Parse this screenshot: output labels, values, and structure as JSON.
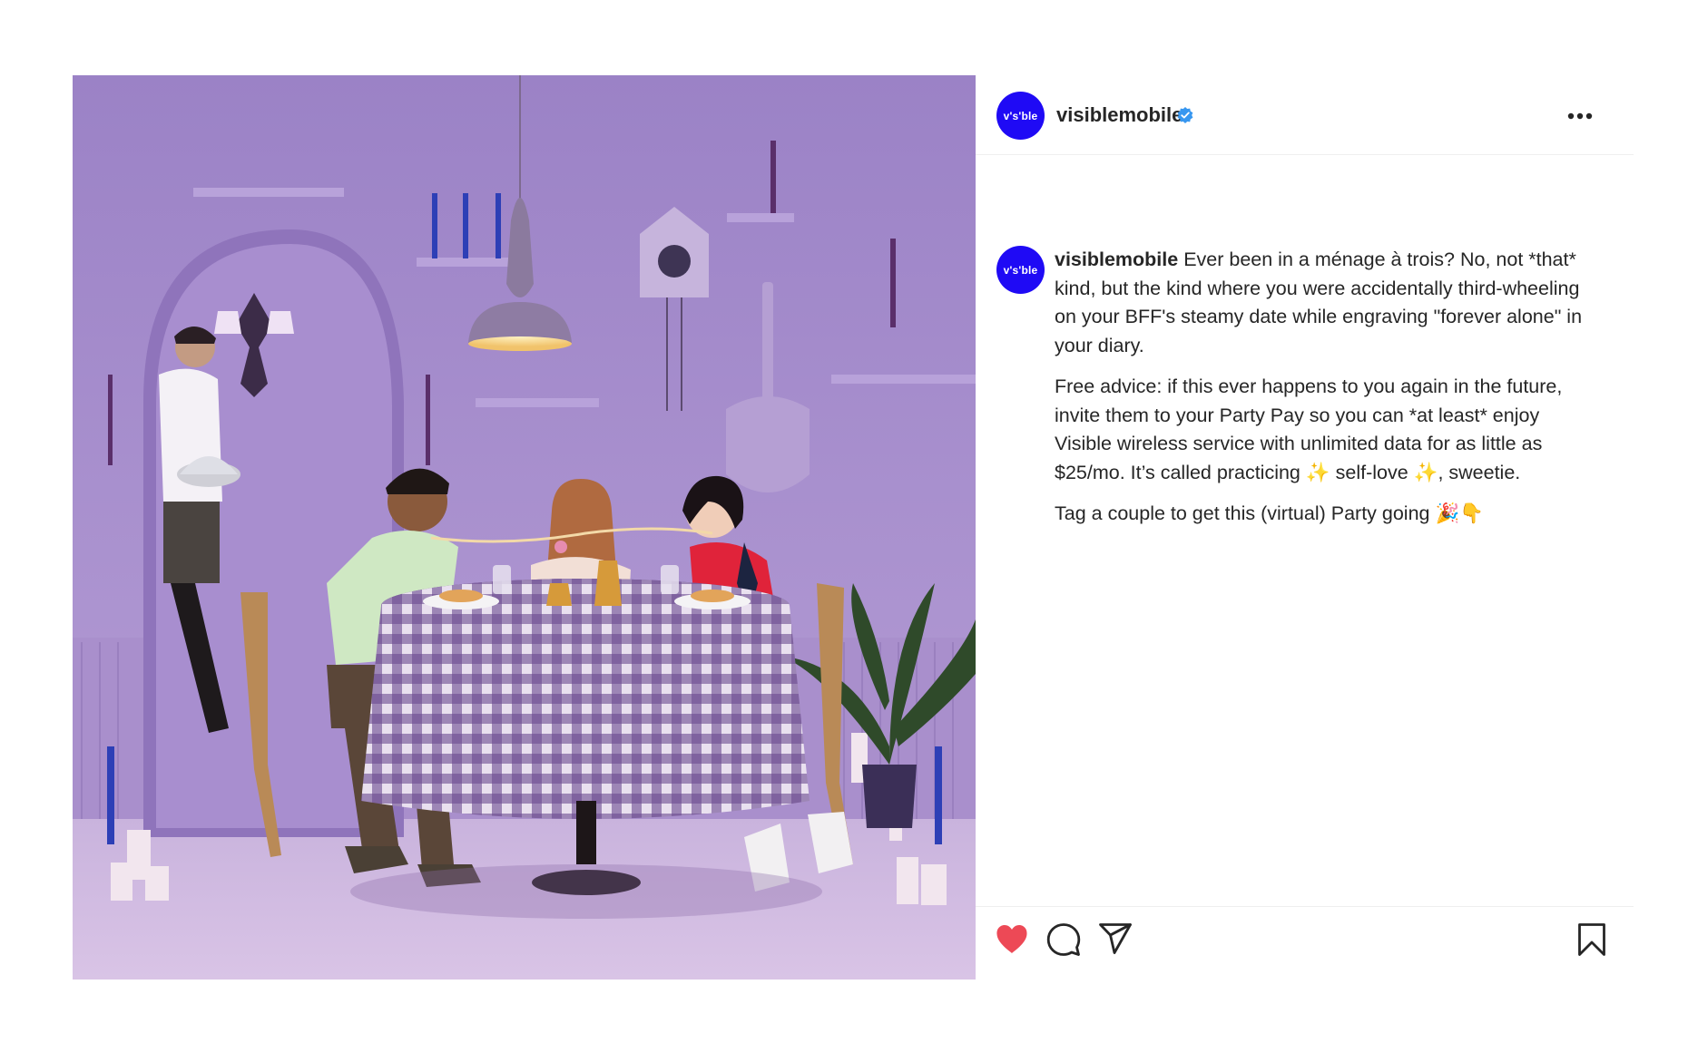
{
  "post": {
    "account": {
      "username": "visiblemobile",
      "avatar_text": "v's'ble",
      "verified": true,
      "brand_color": "#1f0af5",
      "verified_color": "#3897f0"
    },
    "caption": {
      "username": "visiblemobile",
      "para1": "Ever been in a ménage à trois? No, not *that* kind, but the kind where you were accidentally third-wheeling on your BFF's steamy date while engraving \"forever alone\" in your diary.",
      "para2_a": "Free advice: if this ever happens to you again in the future, invite them to your Party Pay so you can *at least* enjoy Visible wireless service with unlimited data for as little as $25/mo. It’s called practicing ",
      "sparkles": "✨",
      "para2_b": " self-love ",
      "para2_c": ", sweetie.",
      "para3": "Tag a couple to get this (virtual) Party going ",
      "para3_emoji": "🎉👇"
    },
    "actions": {
      "like_icon": "heart-icon",
      "liked": true,
      "like_color": "#ed4956",
      "comment_icon": "comment-icon",
      "share_icon": "paper-plane-icon",
      "save_icon": "bookmark-icon",
      "more_icon": "more-horizontal-icon"
    },
    "photo": {
      "background_color": "#9c82c4"
    }
  }
}
